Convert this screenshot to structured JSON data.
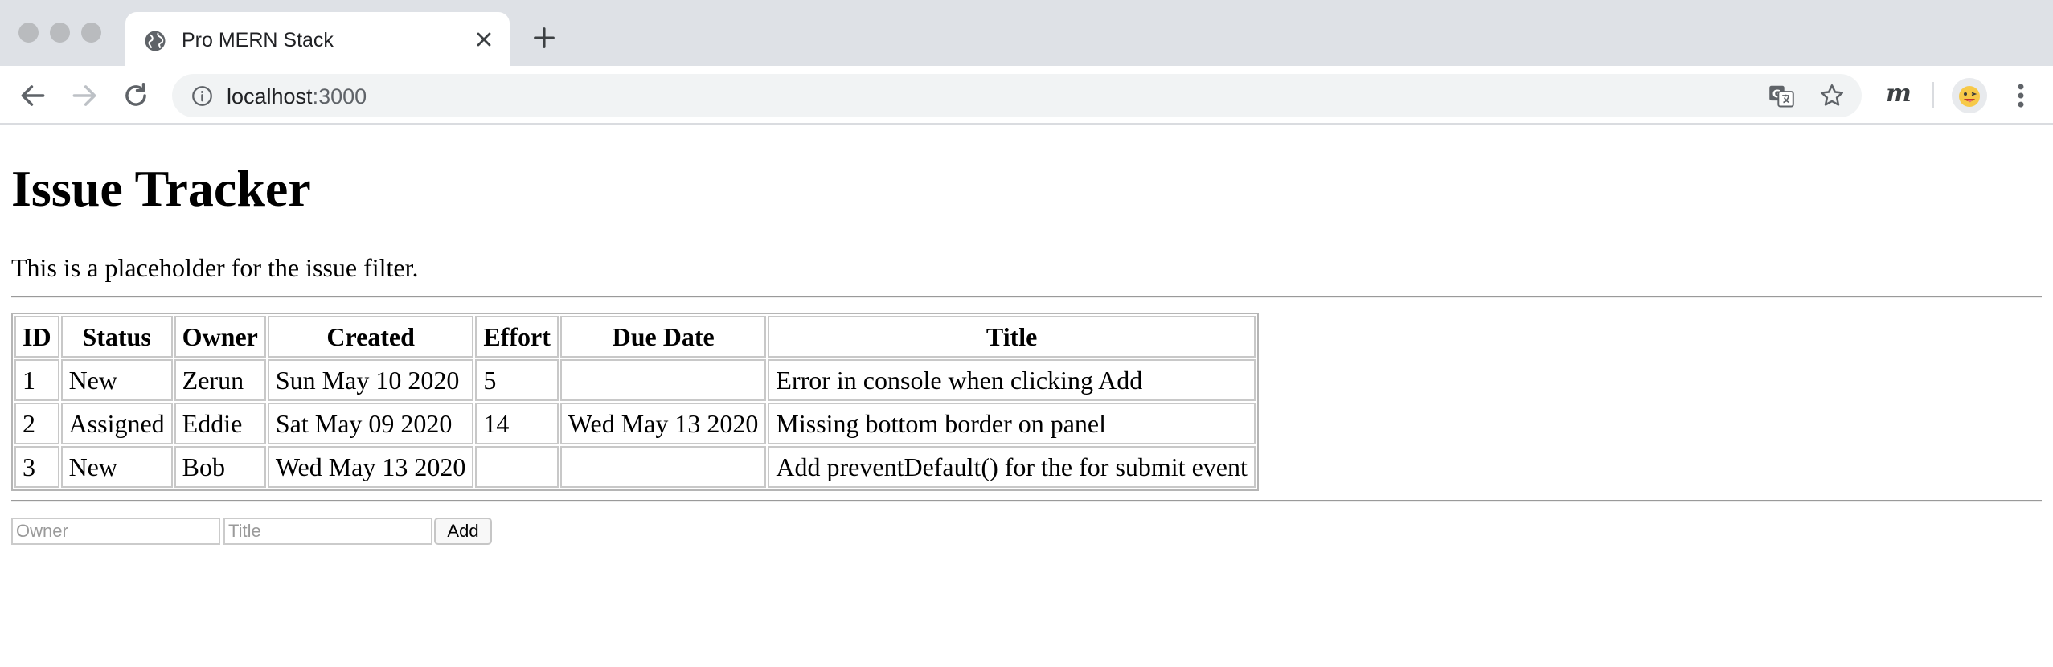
{
  "browser": {
    "tab_title": "Pro MERN Stack",
    "url_host": "localhost",
    "url_port": ":3000",
    "extension_label": "m"
  },
  "page": {
    "title": "Issue Tracker",
    "filter_placeholder_text": "This is a placeholder for the issue filter."
  },
  "issues_table": {
    "headers": [
      "ID",
      "Status",
      "Owner",
      "Created",
      "Effort",
      "Due Date",
      "Title"
    ],
    "rows": [
      [
        "1",
        "New",
        "Zerun",
        "Sun May 10 2020",
        "5",
        "",
        "Error in console when clicking Add"
      ],
      [
        "2",
        "Assigned",
        "Eddie",
        "Sat May 09 2020",
        "14",
        "Wed May 13 2020",
        "Missing bottom border on panel"
      ],
      [
        "3",
        "New",
        "Bob",
        "Wed May 13 2020",
        "",
        "",
        "Add preventDefault() for the for submit event"
      ]
    ]
  },
  "add_form": {
    "owner_placeholder": "Owner",
    "title_placeholder": "Title",
    "add_label": "Add"
  },
  "icons": {
    "favicon": "globe-icon",
    "tab_close": "close-icon",
    "new_tab": "plus-icon",
    "back": "arrow-left-icon",
    "forward": "arrow-right-icon",
    "reload": "reload-icon",
    "site_info": "info-icon",
    "translate": "translate-icon",
    "bookmark": "star-icon",
    "profile": "avatar",
    "menu": "kebab-menu-icon"
  },
  "colors": {
    "tabstrip": "#dee1e6",
    "omnibox": "#f1f3f4",
    "table_border": "#c8c8c8"
  }
}
